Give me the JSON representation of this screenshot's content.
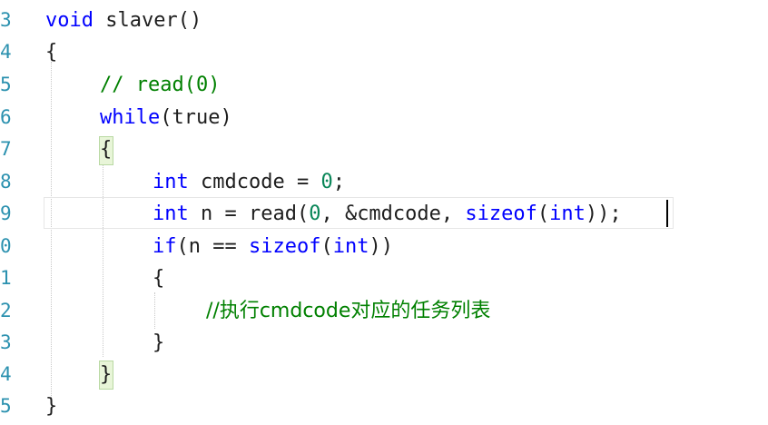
{
  "line_numbers": [
    "3",
    "4",
    "5",
    "6",
    "7",
    "8",
    "9",
    "0",
    "1",
    "2",
    "3",
    "4",
    "5"
  ],
  "code": {
    "l3_void": "void",
    "l3_name": " slaver()",
    "l4_brace": "{",
    "l5_comment": "// read(0)",
    "l6_while": "while",
    "l6_rest": "(true)",
    "l7_brace": "{",
    "l8_int": "int",
    "l8_rest": " cmdcode = ",
    "l8_zero": "0",
    "l8_end": ";",
    "l9_int": "int",
    "l9_a": " n = read(",
    "l9_zero": "0",
    "l9_b": ", &cmdcode, ",
    "l9_sizeof": "sizeof",
    "l9_c": "(",
    "l9_int2": "int",
    "l9_d": "));",
    "l10_if": "if",
    "l10_a": "(n == ",
    "l10_sizeof": "sizeof",
    "l10_b": "(",
    "l10_int": "int",
    "l10_c": "))",
    "l11_brace": "{",
    "l12_comment": "//执行cmdcode对应的任务列表",
    "l13_brace": "}",
    "l14_brace": "}",
    "l15_brace": "}"
  },
  "colors": {
    "keyword": "#0000ff",
    "comment": "#008000",
    "number": "#098658",
    "line_number": "#2b91af",
    "text": "#1e1e1e"
  }
}
